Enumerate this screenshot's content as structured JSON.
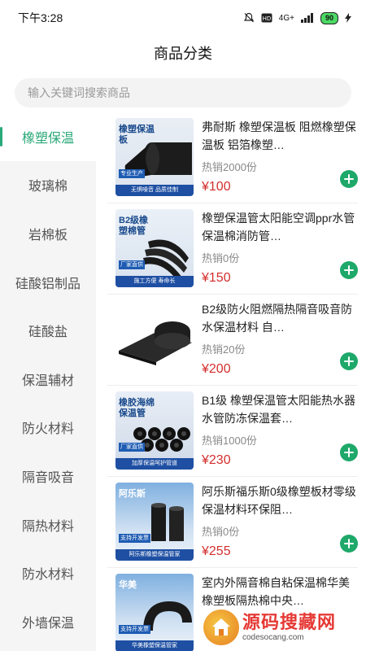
{
  "status": {
    "time": "下午3:28",
    "network": "4G+",
    "battery": "90"
  },
  "page": {
    "title": "商品分类"
  },
  "search": {
    "placeholder": "输入关键词搜索商品"
  },
  "categories": [
    {
      "label": "橡塑保温",
      "active": true
    },
    {
      "label": "玻璃棉"
    },
    {
      "label": "岩棉板"
    },
    {
      "label": "硅酸铝制品"
    },
    {
      "label": "硅酸盐"
    },
    {
      "label": "保温辅材"
    },
    {
      "label": "防火材料"
    },
    {
      "label": "隔音吸音"
    },
    {
      "label": "隔热材料"
    },
    {
      "label": "防水材料"
    },
    {
      "label": "外墙保温"
    }
  ],
  "products": [
    {
      "name": "弗耐斯 橡塑保温板 阻燃橡塑保温板 铝箔橡塑…",
      "sales": "热销2000份",
      "price": "¥100",
      "thumb": {
        "title": "橡塑保温板",
        "tag": "专业生产",
        "banner": "无惧噪音 品质佳制"
      }
    },
    {
      "name": "橡塑保温管太阳能空调ppr水管保温棉消防管…",
      "sales": "热销0份",
      "price": "¥150",
      "thumb": {
        "title": "B2级橡塑棉管",
        "tag": "厂家直供",
        "banner": "施工方便 寿命长"
      }
    },
    {
      "name": "B2级防火阻燃隔热隔音吸音防水保温材料 自…",
      "sales": "热销20份",
      "price": "¥200",
      "thumb": {
        "title": "",
        "tag": "",
        "banner": ""
      }
    },
    {
      "name": "B1级 橡塑保温管太阳能热水器水管防冻保温套…",
      "sales": "热销1000份",
      "price": "¥230",
      "thumb": {
        "title": "橡胶海绵保温管",
        "tag": "厂家直供",
        "banner": "加厚保温呵护管道"
      }
    },
    {
      "name": "阿乐斯福乐斯0级橡塑板材零级保温材料环保阻…",
      "sales": "热销0份",
      "price": "¥255",
      "thumb": {
        "title": "阿乐斯",
        "tag": "支持开发票",
        "banner": "阿乐斯橡塑保温管家"
      }
    },
    {
      "name": "室内外隔音棉自粘保温棉华美橡塑板隔热棉中央…",
      "sales": "",
      "price": "",
      "thumb": {
        "title": "华美",
        "tag": "支持开发票",
        "banner": "华美橡塑保温管家"
      }
    }
  ],
  "watermark": {
    "cn": "源码搜藏网",
    "en": "codesocang.com"
  },
  "colors": {
    "accent": "#2aa978",
    "price": "#d32f2f",
    "add_button": "#1ea86a"
  }
}
